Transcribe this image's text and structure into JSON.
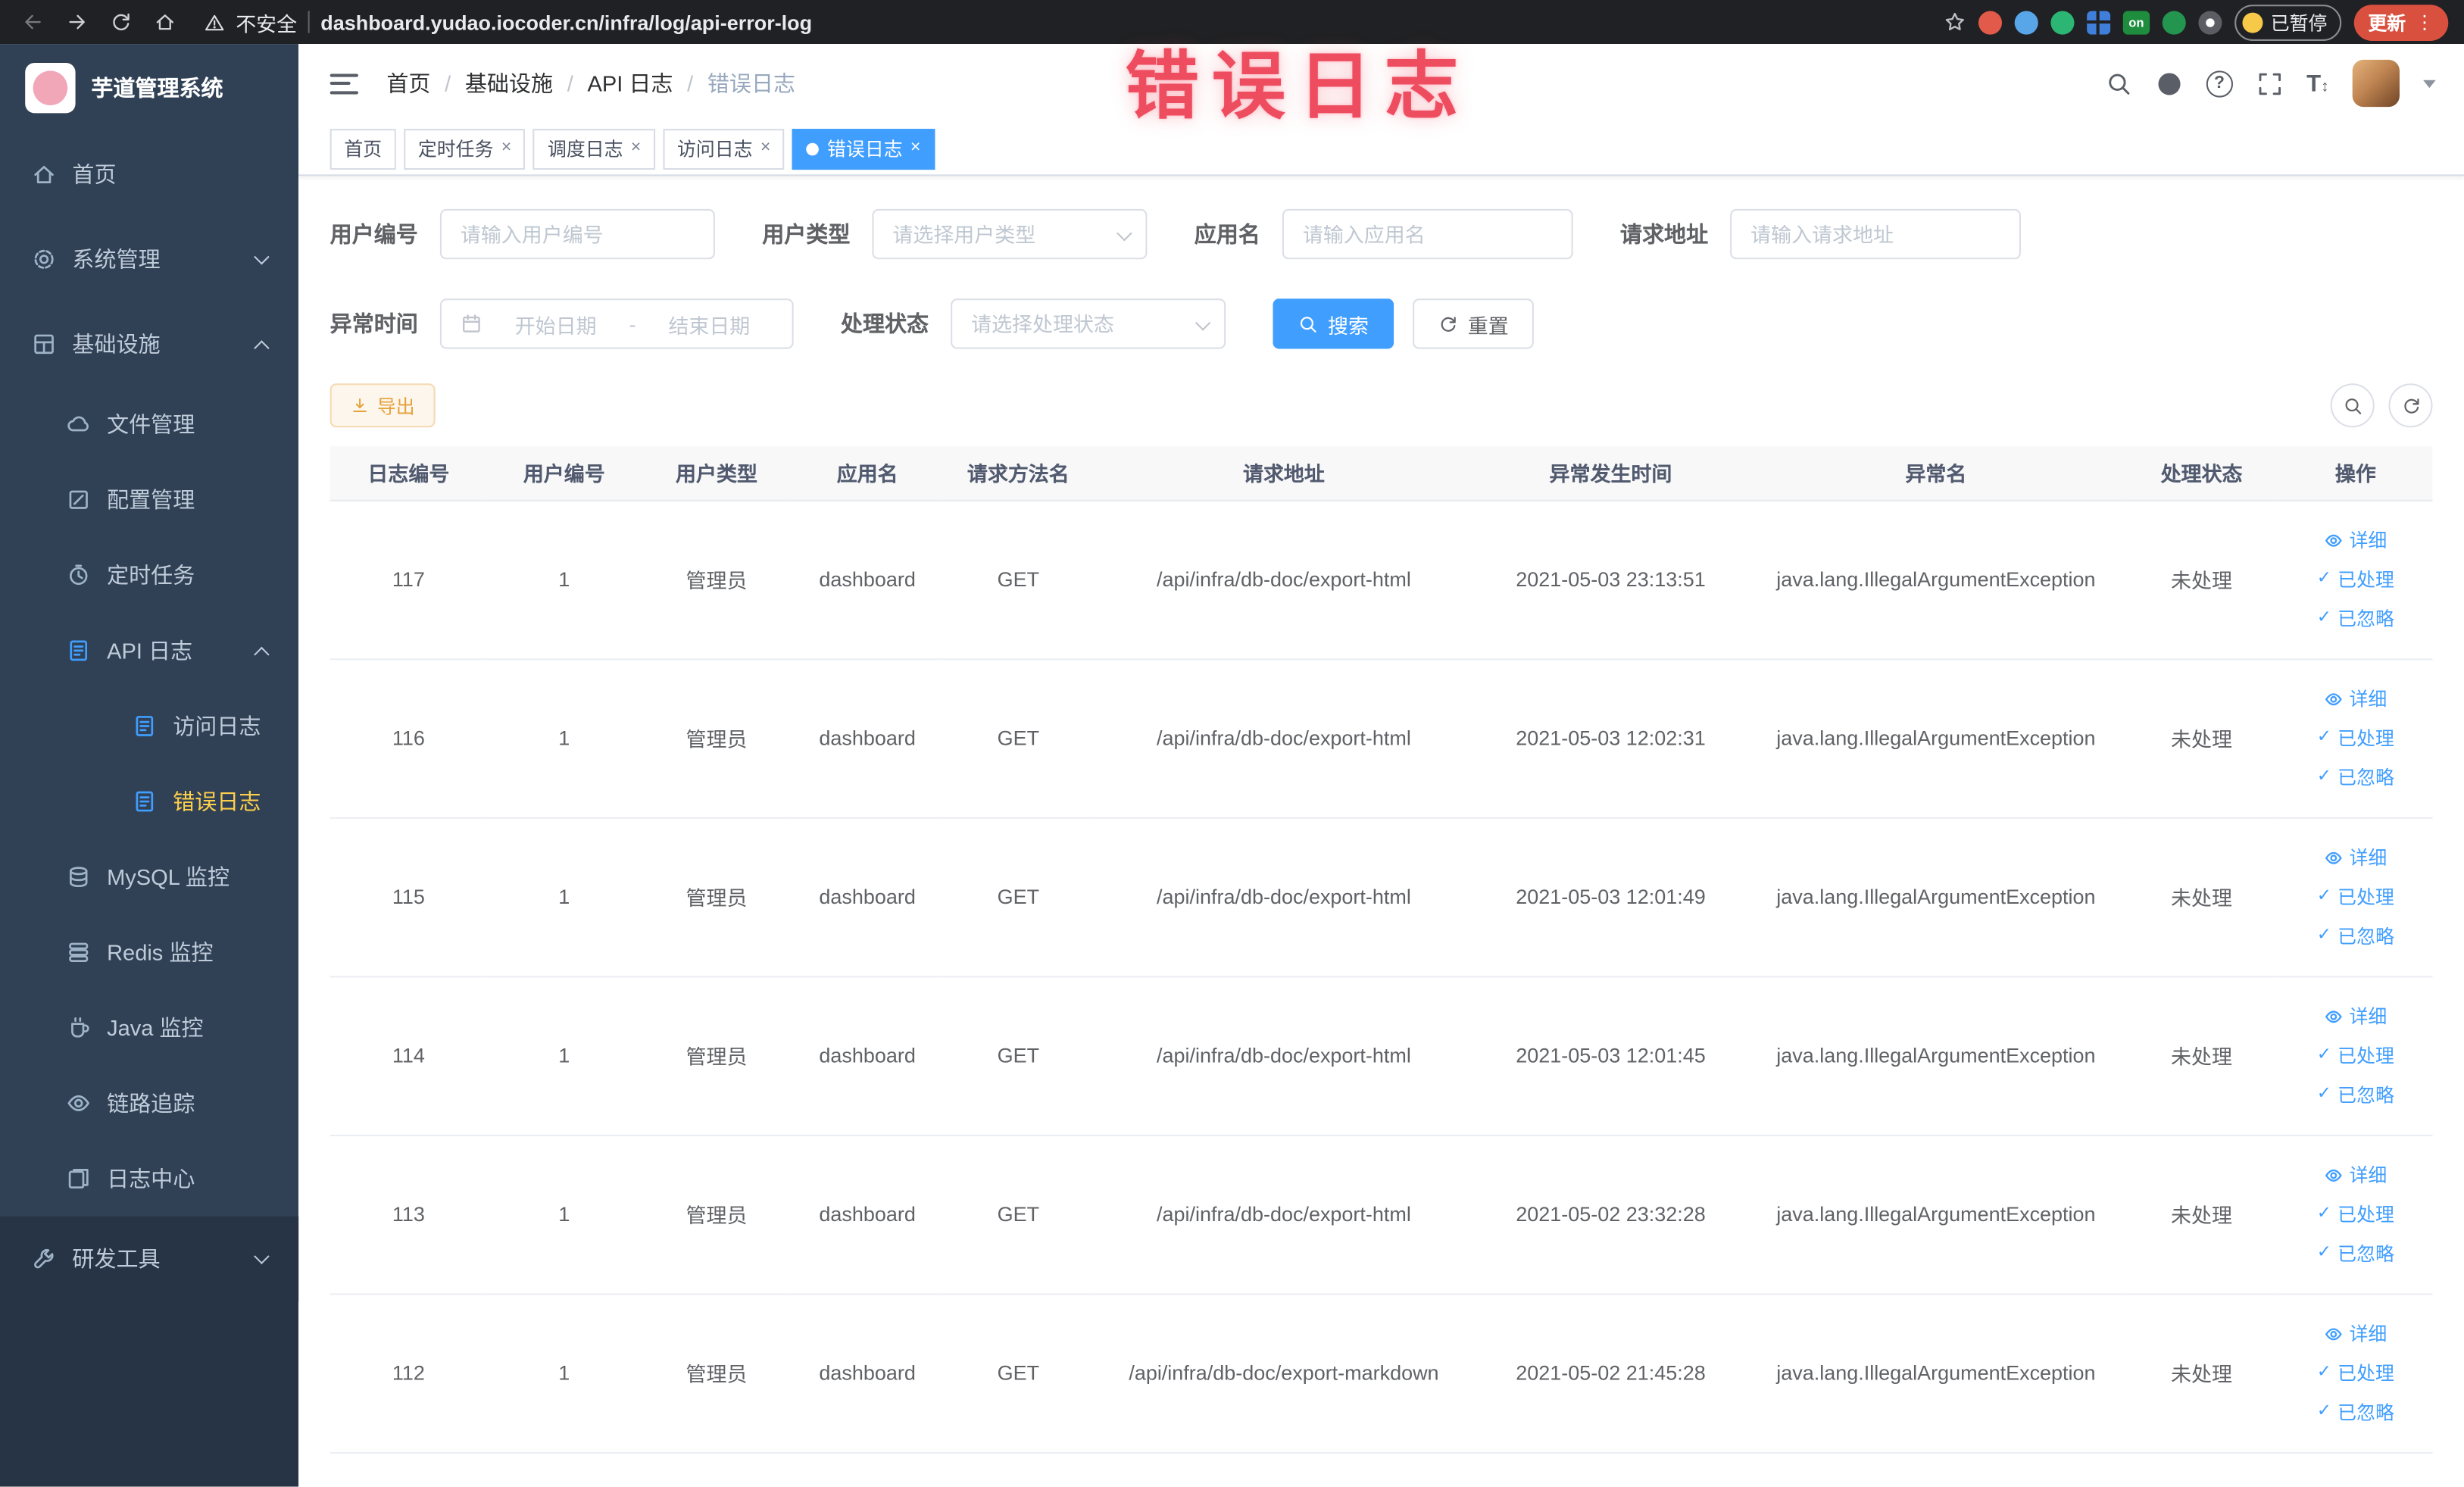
{
  "browser": {
    "security_label": "不安全",
    "url": "dashboard.yudao.iocoder.cn/infra/log/api-error-log",
    "paused_label": "已暂停",
    "update_label": "更新",
    "extension_on_label": "on"
  },
  "watermark_text": "错误日志",
  "sidebar": {
    "logo_title": "芋道管理系统",
    "items": [
      {
        "label": "首页",
        "icon": "home-icon"
      },
      {
        "label": "系统管理",
        "icon": "gear-icon"
      },
      {
        "label": "基础设施",
        "icon": "grid-icon"
      },
      {
        "label": "文件管理",
        "icon": "cloud-icon"
      },
      {
        "label": "配置管理",
        "icon": "edit-icon"
      },
      {
        "label": "定时任务",
        "icon": "timer-icon"
      },
      {
        "label": "API 日志",
        "icon": "document-icon"
      },
      {
        "label": "访问日志",
        "icon": "document-icon"
      },
      {
        "label": "错误日志",
        "icon": "document-icon"
      },
      {
        "label": "MySQL 监控",
        "icon": "database-icon"
      },
      {
        "label": "Redis 监控",
        "icon": "stack-icon"
      },
      {
        "label": "Java 监控",
        "icon": "cup-icon"
      },
      {
        "label": "链路追踪",
        "icon": "eye-icon"
      },
      {
        "label": "日志中心",
        "icon": "documents-icon"
      },
      {
        "label": "研发工具",
        "icon": "tools-icon"
      }
    ]
  },
  "navbar": {
    "breadcrumb": [
      "首页",
      "基础设施",
      "API 日志",
      "错误日志"
    ]
  },
  "tabs": [
    {
      "label": "首页"
    },
    {
      "label": "定时任务"
    },
    {
      "label": "调度日志"
    },
    {
      "label": "访问日志"
    },
    {
      "label": "错误日志"
    }
  ],
  "filters": {
    "user_id_label": "用户编号",
    "user_id_placeholder": "请输入用户编号",
    "user_type_label": "用户类型",
    "user_type_placeholder": "请选择用户类型",
    "app_name_label": "应用名",
    "app_name_placeholder": "请输入应用名",
    "request_url_label": "请求地址",
    "request_url_placeholder": "请输入请求地址",
    "time_label": "异常时间",
    "time_start_placeholder": "开始日期",
    "time_separator": "-",
    "time_end_placeholder": "结束日期",
    "status_label": "处理状态",
    "status_placeholder": "请选择处理状态",
    "search_label": "搜索",
    "reset_label": "重置"
  },
  "toolbar": {
    "export_label": "导出"
  },
  "table": {
    "columns": [
      "日志编号",
      "用户编号",
      "用户类型",
      "应用名",
      "请求方法名",
      "请求地址",
      "异常发生时间",
      "异常名",
      "处理状态",
      "操作"
    ],
    "action_labels": [
      "详细",
      "已处理",
      "已忽略"
    ],
    "rows": [
      {
        "log_id": "117",
        "user_id": "1",
        "user_type": "管理员",
        "app_name": "dashboard",
        "method": "GET",
        "url": "/api/infra/db-doc/export-html",
        "time": "2021-05-03 23:13:51",
        "exception": "java.lang.IllegalArgumentException",
        "status": "未处理"
      },
      {
        "log_id": "116",
        "user_id": "1",
        "user_type": "管理员",
        "app_name": "dashboard",
        "method": "GET",
        "url": "/api/infra/db-doc/export-html",
        "time": "2021-05-03 12:02:31",
        "exception": "java.lang.IllegalArgumentException",
        "status": "未处理"
      },
      {
        "log_id": "115",
        "user_id": "1",
        "user_type": "管理员",
        "app_name": "dashboard",
        "method": "GET",
        "url": "/api/infra/db-doc/export-html",
        "time": "2021-05-03 12:01:49",
        "exception": "java.lang.IllegalArgumentException",
        "status": "未处理"
      },
      {
        "log_id": "114",
        "user_id": "1",
        "user_type": "管理员",
        "app_name": "dashboard",
        "method": "GET",
        "url": "/api/infra/db-doc/export-html",
        "time": "2021-05-03 12:01:45",
        "exception": "java.lang.IllegalArgumentException",
        "status": "未处理"
      },
      {
        "log_id": "113",
        "user_id": "1",
        "user_type": "管理员",
        "app_name": "dashboard",
        "method": "GET",
        "url": "/api/infra/db-doc/export-html",
        "time": "2021-05-02 23:32:28",
        "exception": "java.lang.IllegalArgumentException",
        "status": "未处理"
      },
      {
        "log_id": "112",
        "user_id": "1",
        "user_type": "管理员",
        "app_name": "dashboard",
        "method": "GET",
        "url": "/api/infra/db-doc/export-markdown",
        "time": "2021-05-02 21:45:28",
        "exception": "java.lang.IllegalArgumentException",
        "status": "未处理"
      }
    ]
  },
  "icons": {
    "close": "×",
    "check": "✓",
    "kebab": "⋮",
    "question": "?",
    "font_size": "T",
    "updown": "↕",
    "breadcrumb_separator": "/"
  }
}
